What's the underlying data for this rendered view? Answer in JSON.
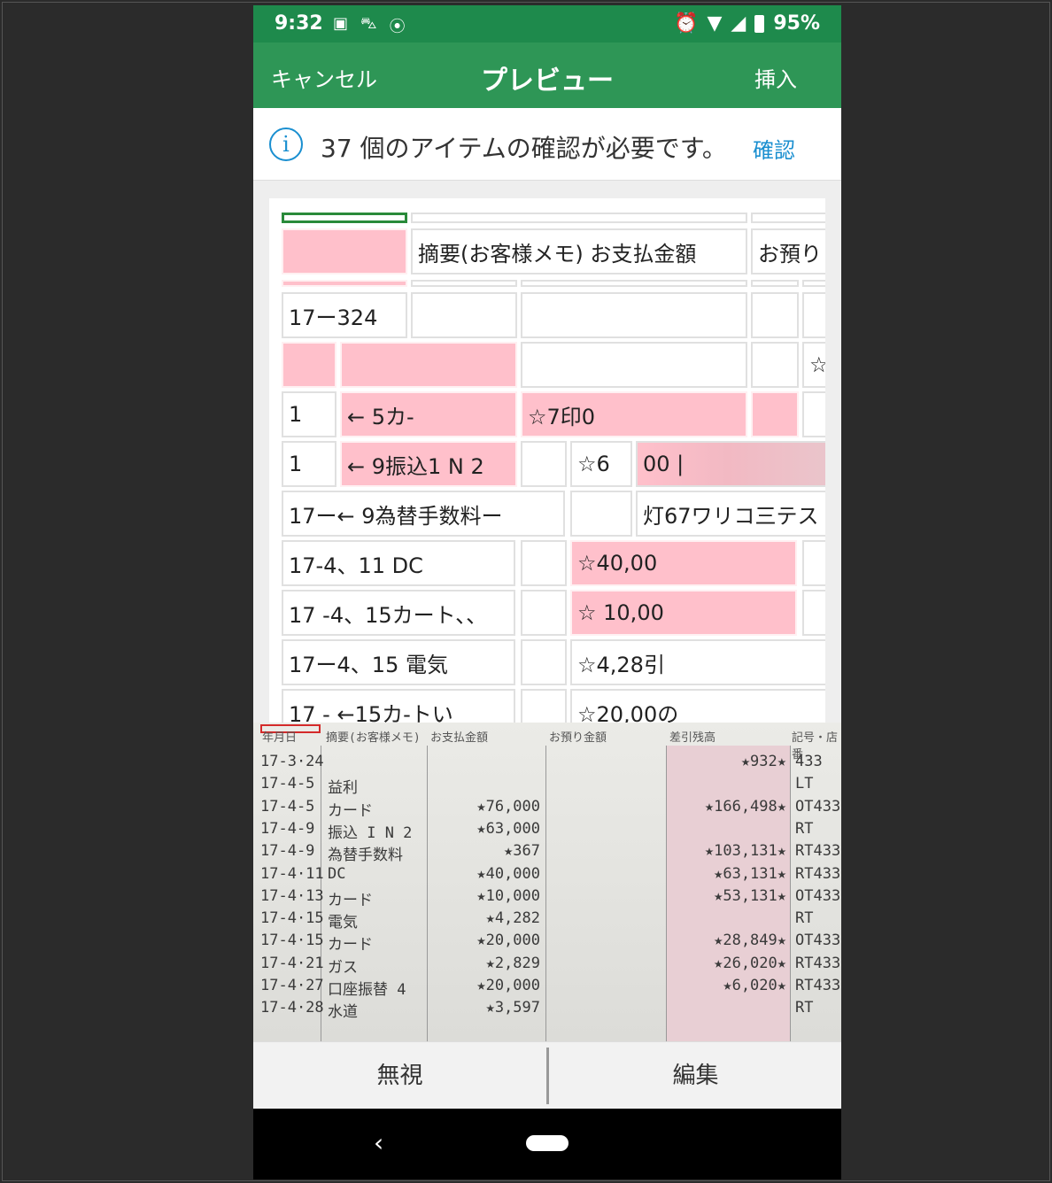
{
  "status_bar": {
    "time": "9:32",
    "battery": "95%",
    "icons": [
      "image-icon",
      "car-icon",
      "location-icon",
      "alarm-icon",
      "wifi-icon",
      "signal-icon",
      "battery-icon"
    ]
  },
  "app_bar": {
    "cancel_label": "キャンセル",
    "title": "プレビュー",
    "insert_label": "挿入"
  },
  "info_bar": {
    "icon_glyph": "i",
    "message": "37 個のアイテムの確認が必要です。",
    "confirm_label": "確認"
  },
  "preview_table": {
    "header_text": "摘要(お客様メモ) お支払金額",
    "header_clip": "お預り",
    "cells": {
      "r2c1": "17ー324",
      "r3star": "☆",
      "r4c1": "1",
      "r4c2": "← 5カ-",
      "r4c3": "☆7印0",
      "r5c1": "1",
      "r5c2": "← 9振込1 N 2",
      "r5c4": "☆6",
      "r5c5": "00 |",
      "r6c1": "17ー← 9為替手数料ー",
      "r6c3": "灯67ワリコ三テス",
      "r7c1": "17-4、11 DC",
      "r7c3": "☆40,00",
      "r8c1": "17 -4、15カート、、",
      "r8c3": "☆ 10,00",
      "r9c1": "17ー4、15 電気",
      "r9c3": "☆4,28引",
      "r10c1": "17 - ←15カ-トい",
      "r10c3": "☆20,00の"
    }
  },
  "scan_image": {
    "headers": [
      "年月日",
      "摘要(お客様メモ)",
      "お支払金額",
      "お預り金額",
      "差引残高",
      "記号・店番"
    ],
    "rows": [
      {
        "date": "17-3·24",
        "memo": "",
        "pay": "",
        "balance": "★932★",
        "code": "433"
      },
      {
        "date": "17-4-5",
        "memo": "益利",
        "pay": "",
        "balance": "",
        "code": "LT"
      },
      {
        "date": "17-4-5",
        "memo": "カード",
        "pay": "★76,000",
        "balance": "★166,498★",
        "code": "OT433"
      },
      {
        "date": "17-4-9",
        "memo": "振込 I N 2",
        "pay": "★63,000",
        "balance": "",
        "code": "RT"
      },
      {
        "date": "17-4-9",
        "memo": "為替手数料",
        "pay": "★367",
        "balance": "★103,131★",
        "code": "RT433"
      },
      {
        "date": "17-4·11",
        "memo": "DC",
        "pay": "★40,000",
        "balance": "★63,131★",
        "code": "RT433"
      },
      {
        "date": "17-4·13",
        "memo": "カード",
        "pay": "★10,000",
        "balance": "★53,131★",
        "code": "OT433"
      },
      {
        "date": "17-4·15",
        "memo": "電気",
        "pay": "★4,282",
        "balance": "",
        "code": "RT"
      },
      {
        "date": "17-4·15",
        "memo": "カード",
        "pay": "★20,000",
        "balance": "★28,849★",
        "code": "OT433"
      },
      {
        "date": "17-4·21",
        "memo": "ガス",
        "pay": "★2,829",
        "balance": "★26,020★",
        "code": "RT433"
      },
      {
        "date": "17-4·27",
        "memo": "口座振替 4",
        "pay": "★20,000",
        "balance": "★6,020★",
        "code": "RT433"
      },
      {
        "date": "17-4·28",
        "memo": "水道",
        "pay": "★3,597",
        "balance": "",
        "code": "RT"
      }
    ]
  },
  "actions": {
    "ignore_label": "無視",
    "edit_label": "編集"
  },
  "nav": {
    "back_glyph": "‹"
  }
}
